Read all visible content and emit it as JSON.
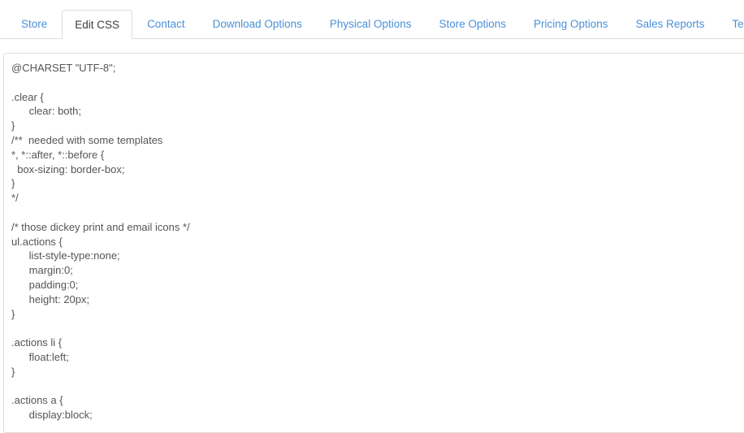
{
  "colors": {
    "tab_link": "#4a90d9",
    "tab_active_text": "#3c3c3c",
    "border": "#dddddd",
    "code_text": "#555555",
    "background": "#ffffff"
  },
  "tabs": [
    {
      "label": "Store",
      "active": false
    },
    {
      "label": "Edit CSS",
      "active": true
    },
    {
      "label": "Contact",
      "active": false
    },
    {
      "label": "Download Options",
      "active": false
    },
    {
      "label": "Physical Options",
      "active": false
    },
    {
      "label": "Store Options",
      "active": false
    },
    {
      "label": "Pricing Options",
      "active": false
    },
    {
      "label": "Sales Reports",
      "active": false
    },
    {
      "label": "Testing",
      "active": false
    }
  ],
  "editor": {
    "language": "css",
    "content": "@CHARSET \"UTF-8\";\n\n.clear {\n\tclear: both;\n}\n/**  needed with some templates\n*, *::after, *::before {\n  box-sizing: border-box;\n}\n*/\n\n/* those dickey print and email icons */\nul.actions {\n\tlist-style-type:none;\n\tmargin:0;\n\tpadding:0;\n\theight: 20px;\n}\n\n.actions li {\n\tfloat:left;\n}\n\n.actions a {\n\tdisplay:block;\n"
  }
}
